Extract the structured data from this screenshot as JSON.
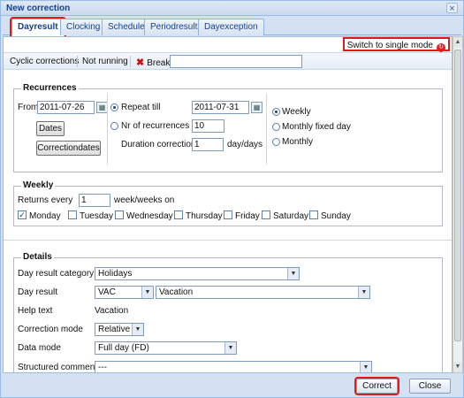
{
  "window": {
    "title": "New correction"
  },
  "tabs": [
    {
      "label": "Dayresult",
      "active": true
    },
    {
      "label": "Clocking",
      "active": false
    },
    {
      "label": "Schedule",
      "active": false
    },
    {
      "label": "Periodresult",
      "active": false
    },
    {
      "label": "Dayexception",
      "active": false
    }
  ],
  "single_mode_label": "Switch to single mode",
  "toolbar": {
    "cyclic": "Cyclic corrections",
    "status": "Not running",
    "break_label": "Break",
    "break_value": ""
  },
  "recurrences": {
    "legend": "Recurrences",
    "from_label": "From",
    "from_value": "2011-07-26",
    "dates_button": "Dates",
    "correctiondates_button": "Correctiondates",
    "repeat_till_label": "Repeat till",
    "repeat_till_value": "2011-07-31",
    "nr_label": "Nr of recurrences",
    "nr_value": "10",
    "duration_label": "Duration correction",
    "duration_value": "1",
    "duration_unit": "day/days",
    "weekly": "Weekly",
    "monthly_fixed": "Monthly fixed day",
    "monthly": "Monthly"
  },
  "weekly": {
    "legend": "Weekly",
    "returns_label": "Returns every",
    "returns_value": "1",
    "returns_unit": "week/weeks on",
    "days": [
      {
        "label": "Monday",
        "checked": true
      },
      {
        "label": "Tuesday",
        "checked": false
      },
      {
        "label": "Wednesday",
        "checked": false
      },
      {
        "label": "Thursday",
        "checked": false
      },
      {
        "label": "Friday",
        "checked": false
      },
      {
        "label": "Saturday",
        "checked": false
      },
      {
        "label": "Sunday",
        "checked": false
      }
    ]
  },
  "details": {
    "legend": "Details",
    "category_label": "Day result category",
    "category_value": "Holidays",
    "dayresult_label": "Day result",
    "dayresult_code": "VAC",
    "dayresult_value": "Vacation",
    "helptext_label": "Help text",
    "helptext_value": "Vacation",
    "mode_label": "Correction mode",
    "mode_value": "Relative",
    "datamode_label": "Data mode",
    "datamode_value": "Full day (FD)",
    "comment_label": "Structured comment",
    "comment_value": "---"
  },
  "footer": {
    "correct": "Correct",
    "close": "Close"
  }
}
